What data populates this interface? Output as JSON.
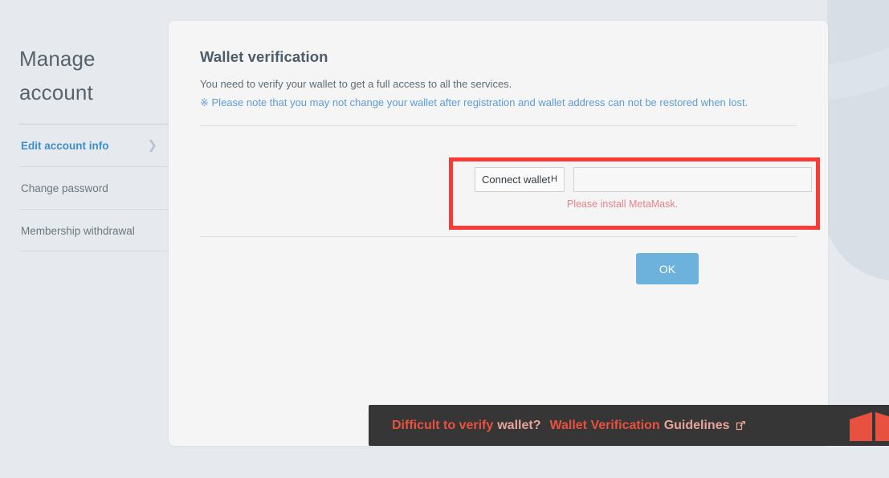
{
  "sidebar": {
    "title": "Manage account",
    "items": [
      {
        "label": "Edit account info",
        "active": true,
        "chevron": "chevron-right-icon"
      },
      {
        "label": "Change password",
        "active": false
      },
      {
        "label": "Membership withdrawal",
        "active": false
      }
    ]
  },
  "panel": {
    "title": "Wallet verification",
    "description": "You need to verify your wallet to get a full access to all the services.",
    "note": "※ Please note that you may not change your wallet after registration and wallet address can not be restored when lost."
  },
  "form": {
    "wallet_select": {
      "selected": "Connect wallet",
      "options": [
        "Connect wallet"
      ]
    },
    "address_input": {
      "value": "",
      "placeholder": ""
    },
    "error_message": "Please install MetaMask.",
    "highlight_color": "#f93a35"
  },
  "actions": {
    "ok_label": "OK",
    "ok_color": "#6cb2dd"
  },
  "banner": {
    "text_1": "Difficult to verify",
    "text_2": "wallet?",
    "text_3": "Wallet Verification",
    "text_4": "Guidelines",
    "link_icon": "external-link-icon",
    "accent_color": "#e8513f",
    "background_color": "#363636"
  }
}
